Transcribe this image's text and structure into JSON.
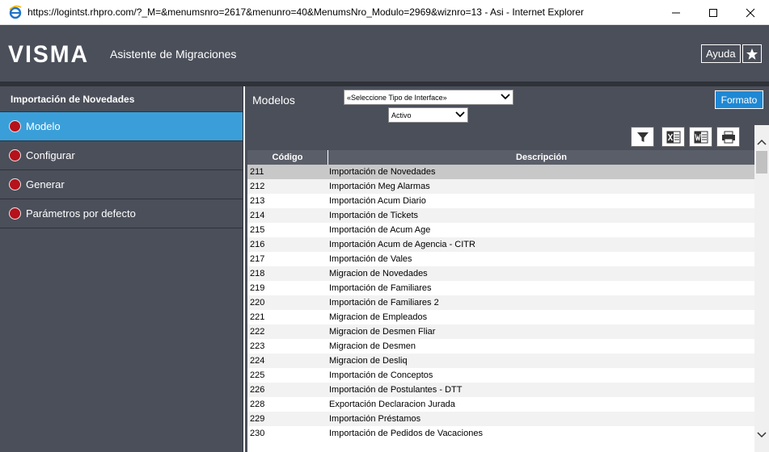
{
  "window": {
    "title": "https://logintst.rhpro.com/?_M=&menumsnro=2617&menunro=40&MenumsNro_Modulo=2969&wiznro=13 - Asi - Internet Explorer",
    "controls": [
      "minimize-icon",
      "maximize-icon",
      "close-icon"
    ]
  },
  "header": {
    "brand": "VISMA",
    "app_title": "Asistente de Migraciones",
    "help_label": "Ayuda",
    "favorite_icon": "star-icon"
  },
  "sidebar": {
    "title": "Importación de Novedades",
    "items": [
      {
        "label": "Modelo",
        "active": true
      },
      {
        "label": "Configurar",
        "active": false
      },
      {
        "label": "Generar",
        "active": false
      },
      {
        "label": "Parámetros por defecto",
        "active": false
      }
    ]
  },
  "main": {
    "section_label": "Modelos",
    "interface_select": "«Seleccione Tipo de Interface»",
    "status_select": "Activo",
    "format_button": "Formato",
    "toolbar_icons": [
      "filter-icon",
      "excel-export-icon",
      "word-export-icon",
      "print-icon"
    ],
    "columns": [
      "Código",
      "Descripción"
    ],
    "rows": [
      {
        "code": "211",
        "desc": "Importación de Novedades",
        "selected": true
      },
      {
        "code": "212",
        "desc": "Importación Meg Alarmas"
      },
      {
        "code": "213",
        "desc": "Importación Acum Diario"
      },
      {
        "code": "214",
        "desc": "Importación de Tickets"
      },
      {
        "code": "215",
        "desc": "Importación de Acum Age"
      },
      {
        "code": "216",
        "desc": "Importación Acum de Agencia - CITR"
      },
      {
        "code": "217",
        "desc": "Importación de Vales"
      },
      {
        "code": "218",
        "desc": "Migracion de Novedades"
      },
      {
        "code": "219",
        "desc": "Importación de Familiares"
      },
      {
        "code": "220",
        "desc": "Importación de Familiares 2"
      },
      {
        "code": "221",
        "desc": "Migracion de Empleados"
      },
      {
        "code": "222",
        "desc": "Migracion de Desmen Fliar"
      },
      {
        "code": "223",
        "desc": "Migracion de Desmen"
      },
      {
        "code": "224",
        "desc": "Migracion de Desliq"
      },
      {
        "code": "225",
        "desc": "Importación de Conceptos"
      },
      {
        "code": "226",
        "desc": "Importación de Postulantes - DTT"
      },
      {
        "code": "228",
        "desc": "Exportación Declaracion Jurada"
      },
      {
        "code": "229",
        "desc": "Importación Préstamos"
      },
      {
        "code": "230",
        "desc": "Importación de Pedidos de Vacaciones"
      }
    ]
  },
  "colors": {
    "header_bg": "#4b4f5a",
    "accent": "#3a9fd9",
    "status_dot": "#b5121b",
    "format_button": "#1e88d4"
  }
}
